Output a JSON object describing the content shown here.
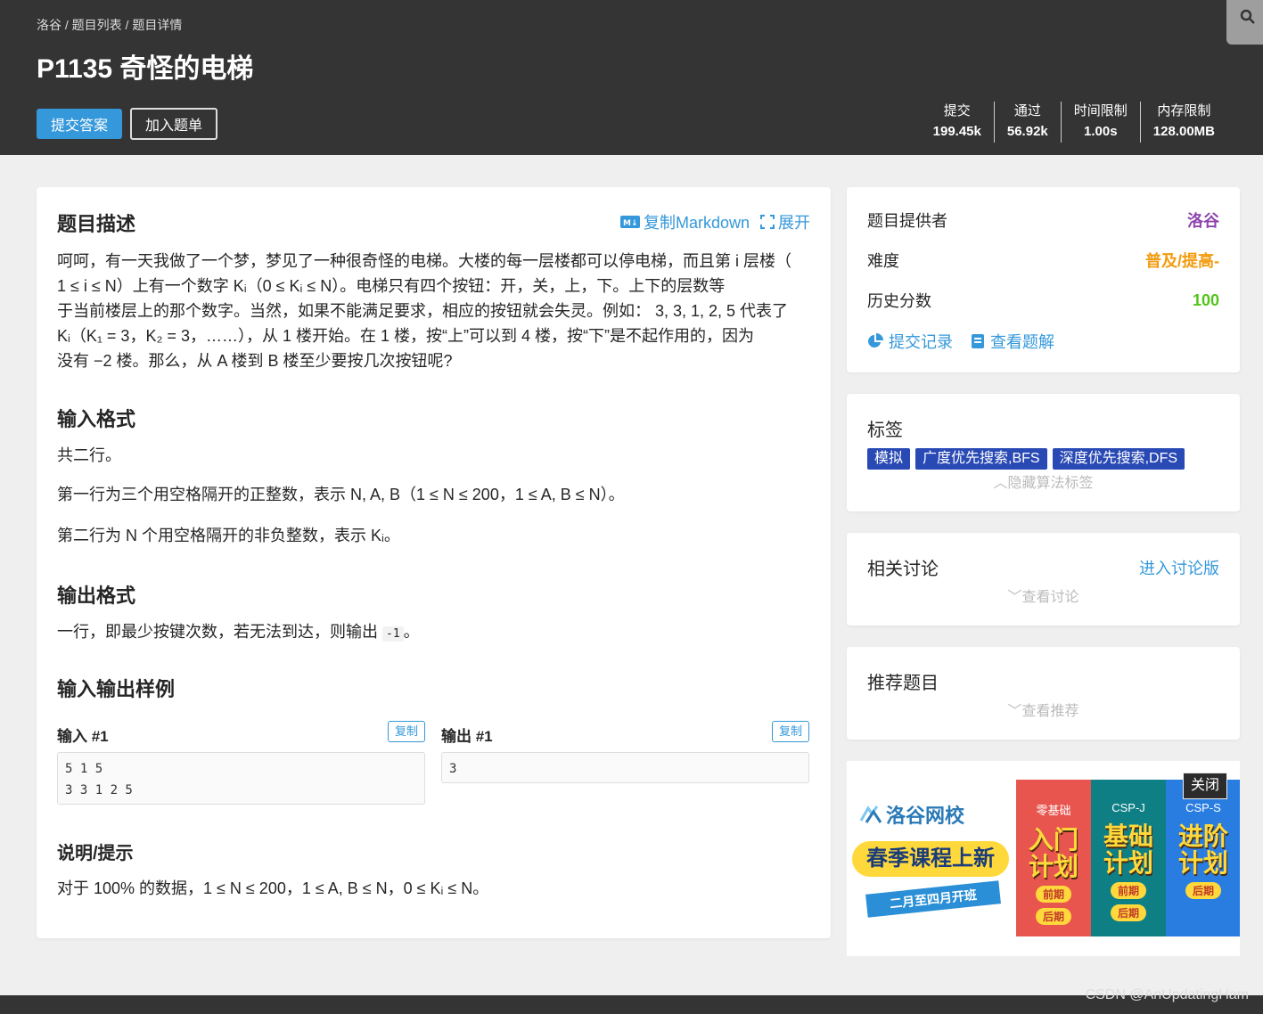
{
  "header": {
    "breadcrumb": [
      "洛谷",
      "题目列表",
      "题目详情"
    ],
    "breadcrumb_sep": " / ",
    "title": "P1135 奇怪的电梯",
    "submit_label": "提交答案",
    "add_list_label": "加入题单",
    "stats": [
      {
        "label": "提交",
        "value": "199.45k"
      },
      {
        "label": "通过",
        "value": "56.92k"
      },
      {
        "label": "时间限制",
        "value": "1.00s"
      },
      {
        "label": "内存限制",
        "value": "128.00MB"
      }
    ]
  },
  "problem": {
    "description_title": "题目描述",
    "copy_markdown": "复制Markdown",
    "expand": "展开",
    "description_lines": [
      "呵呵，有一天我做了一个梦，梦见了一种很奇怪的电梯。大楼的每一层楼都可以停电梯，而且第 i 层楼（",
      "1 ≤ i ≤ N）上有一个数字 Kᵢ（0 ≤ Kᵢ ≤ N）。电梯只有四个按钮：开，关，上，下。上下的层数等",
      "于当前楼层上的那个数字。当然，如果不能满足要求，相应的按钮就会失灵。例如： 3, 3, 1, 2, 5 代表了",
      "Kᵢ（K₁ = 3，K₂ = 3，……），从 1 楼开始。在 1 楼，按“上”可以到 4 楼，按“下”是不起作用的，因为",
      "没有 −2 楼。那么，从 A 楼到 B 楼至少要按几次按钮呢?"
    ],
    "input_title": "输入格式",
    "input_lines": [
      "共二行。",
      "第一行为三个用空格隔开的正整数，表示 N, A, B（1 ≤ N ≤ 200，1 ≤ A, B ≤ N）。",
      "第二行为 N 个用空格隔开的非负整数，表示 Kᵢ。"
    ],
    "output_title": "输出格式",
    "output_prefix": "一行，即最少按键次数，若无法到达，则输出 ",
    "output_code": "-1",
    "output_suffix": "。",
    "samples_title": "输入输出样例",
    "sample_input_label": "输入 #1",
    "sample_output_label": "输出 #1",
    "copy_label": "复制",
    "sample_input": "5 1 5\n3 3 1 2 5",
    "sample_output": "3",
    "hint_title": "说明/提示",
    "hint_text": "对于 100% 的数据，1 ≤ N ≤ 200，1 ≤ A, B ≤ N，0 ≤ Kᵢ ≤ N。"
  },
  "sidebar": {
    "info": {
      "provider_label": "题目提供者",
      "provider_value": "洛谷",
      "difficulty_label": "难度",
      "difficulty_value": "普及/提高-",
      "score_label": "历史分数",
      "score_value": "100",
      "records_link": "提交记录",
      "solutions_link": "查看题解"
    },
    "tags": {
      "title": "标签",
      "items": [
        "模拟",
        "广度优先搜索,BFS",
        "深度优先搜索,DFS"
      ],
      "hide_toggle": "隐藏算法标签"
    },
    "discussion": {
      "title": "相关讨论",
      "link": "进入讨论版",
      "toggle": "查看讨论"
    },
    "recommend": {
      "title": "推荐题目",
      "toggle": "查看推荐"
    }
  },
  "ad": {
    "logo": "洛谷网校",
    "headline": "春季课程上新",
    "subline": "二月至四月开班",
    "close": "关闭",
    "columns": [
      {
        "caption": "零基础",
        "big1": "入门",
        "big2": "计划",
        "pills": [
          "前期",
          "后期"
        ]
      },
      {
        "caption": "CSP-J",
        "big1": "基础",
        "big2": "计划",
        "pills": [
          "前期",
          "后期"
        ]
      },
      {
        "caption": "CSP-S",
        "big1": "进阶",
        "big2": "计划",
        "pills": [
          "后期"
        ]
      }
    ]
  },
  "watermark": "CSDN @AnUpdatingHam",
  "colors": {
    "header_bg": "#343434",
    "accent": "#3498db",
    "provider": "#8e44ad",
    "difficulty": "#f39c11",
    "score": "#52c41a",
    "tag": "#2949b4"
  }
}
